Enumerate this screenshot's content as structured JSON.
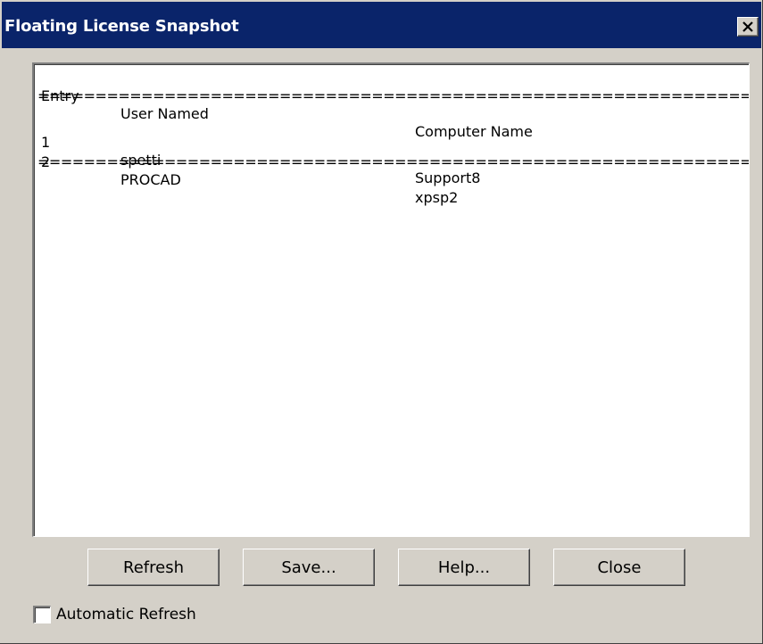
{
  "window": {
    "title": "Floating License Snapshot",
    "close_symbol": "×"
  },
  "list": {
    "header": {
      "entry": "Entry",
      "user": "User Named",
      "computer": "Computer Name"
    },
    "separator": "============================================================================================",
    "rows": [
      {
        "entry": "1",
        "user": "spetti",
        "computer": "Support8"
      },
      {
        "entry": "2",
        "user": "PROCAD",
        "computer": "xpsp2"
      }
    ]
  },
  "buttons": {
    "refresh": "Refresh",
    "save": "Save...",
    "help": "Help...",
    "close": "Close"
  },
  "auto_refresh": {
    "label": "Automatic Refresh",
    "checked": false
  },
  "colors": {
    "titlebar": "#0a246a",
    "face": "#d4d0c8",
    "list_bg": "#ffffff"
  }
}
